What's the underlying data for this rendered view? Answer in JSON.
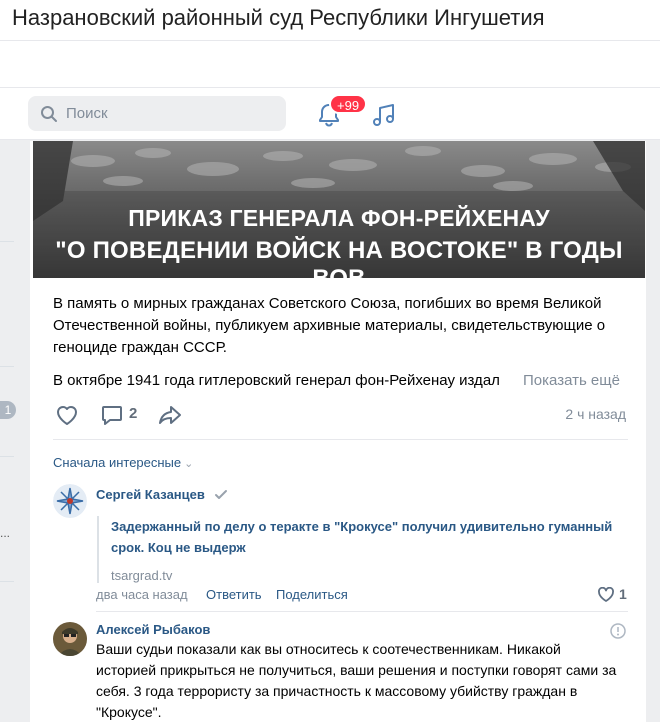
{
  "window": {
    "title": "Назрановский районный суд Республики Ингушетия"
  },
  "header": {
    "search_placeholder": "Поиск",
    "notifications_badge": "+99"
  },
  "left_rail": {
    "badge": "1",
    "dots": "..."
  },
  "post": {
    "banner_line1": "ПРИКАЗ ГЕНЕРАЛА ФОН-РЕЙХЕНАУ",
    "banner_line2": "\"О ПОВЕДЕНИИ ВОЙСК НА ВОСТОКЕ\" В ГОДЫ ВОВ",
    "text_para1": "В память о мирных гражданах Советского Союза, погибших во время Великой Отечественной войны, публикуем архивные материалы, свидетельствующие о геноциде граждан СССР.",
    "text_para2": "В октябре 1941 года гитлеровский генерал фон-Рейхенау издал",
    "show_more": "Показать ещё",
    "comments_count": "2",
    "time": "2 ч назад"
  },
  "comments": {
    "sort_label": "Сначала интересные",
    "items": [
      {
        "author": "Сергей Казанцев",
        "attachment_title": "Задержанный по делу о теракте в \"Крокусе\" получил удивительно гуманный срок. Коц не выдерж",
        "attachment_domain": "tsargrad.tv",
        "time": "два часа назад",
        "reply_label": "Ответить",
        "share_label": "Поделиться",
        "likes": "1"
      },
      {
        "author": "Алексей Рыбаков",
        "text": "Ваши судьи показали как вы относитесь к соотечественникам. Никакой историей прикрыться не получиться, ваши решения и поступки говорят сами за себя. 3 года террористу за причастность к массовому убийству граждан в \"Крокусе\"."
      }
    ]
  },
  "colors": {
    "link": "#2a5885",
    "badge_red": "#ff3347",
    "muted": "#818c99",
    "icon_blue": "#5181b8"
  },
  "icons": [
    "search-icon",
    "bell-icon",
    "music-note-icon",
    "heart-icon",
    "comment-icon",
    "share-arrow-icon",
    "chevron-down-icon",
    "verified-check-icon",
    "report-icon"
  ]
}
